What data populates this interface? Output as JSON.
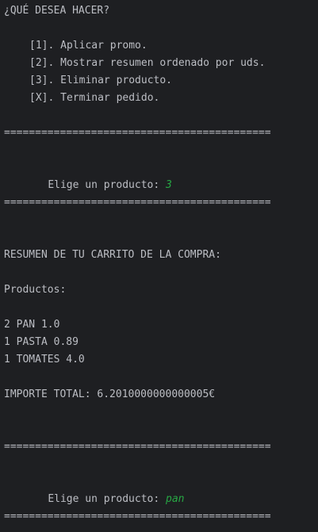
{
  "menu": {
    "prompt": "¿QUÉ DESEA HACER?",
    "options": [
      "[1]. Aplicar promo.",
      "[2]. Mostrar resumen ordenado por uds.",
      "[3]. Eliminar producto.",
      "[X]. Terminar pedido."
    ]
  },
  "separator": "===========================================",
  "prompt1": {
    "label": "Elige un producto: ",
    "input": "3"
  },
  "summary": {
    "title": "RESUMEN DE TU CARRITO DE LA COMPRA:",
    "products_label": "Productos:",
    "items": [
      "2 PAN 1.0",
      "1 PASTA 0.89",
      "1 TOMATES 4.0"
    ],
    "total": "IMPORTE TOTAL: 6.2010000000000005€"
  },
  "prompt2": {
    "label": "Elige un producto: ",
    "input": "pan"
  },
  "colors": {
    "background": "#1e1f22",
    "text": "#bcbec4",
    "user_input": "#27a844"
  }
}
